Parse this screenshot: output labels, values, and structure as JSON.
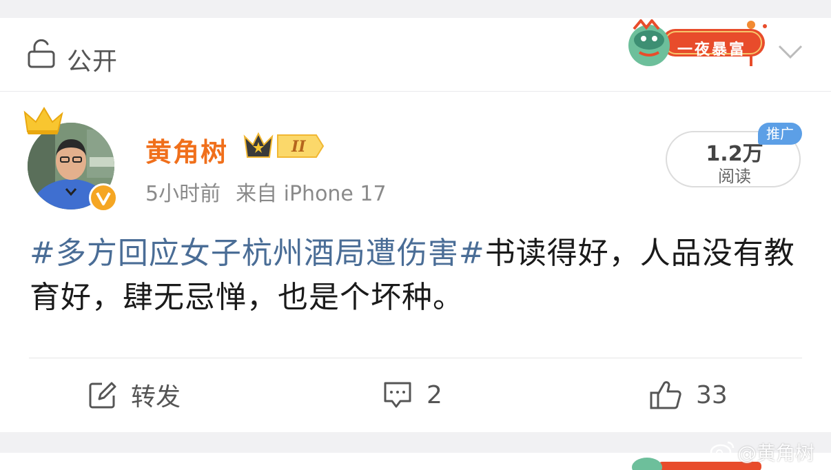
{
  "privacy": {
    "label": "公开",
    "icon": "lock-icon"
  },
  "header_badge": {
    "text": "一夜暴富",
    "icon": "festival-dragon-icon"
  },
  "post": {
    "author": {
      "name": "黄角树",
      "rank_text": "II",
      "verified": true
    },
    "meta": {
      "time": "5小时前",
      "source": "来自 iPhone 17"
    },
    "reads": {
      "count": "1.2万",
      "label": "阅读"
    },
    "promo_tag": "推广",
    "content": {
      "hashtag": "#多方回应女子杭州酒局遭伤害#",
      "text": "书读得好，人品没有教育好，肆无忌惮，也是个坏种。"
    },
    "actions": {
      "repost_label": "转发",
      "comment_count": "2",
      "like_count": "33"
    }
  },
  "watermark": "@黄角树",
  "colors": {
    "username": "#f06f1b",
    "hashtag": "#4a6d96",
    "promo": "#5c9fe6"
  }
}
